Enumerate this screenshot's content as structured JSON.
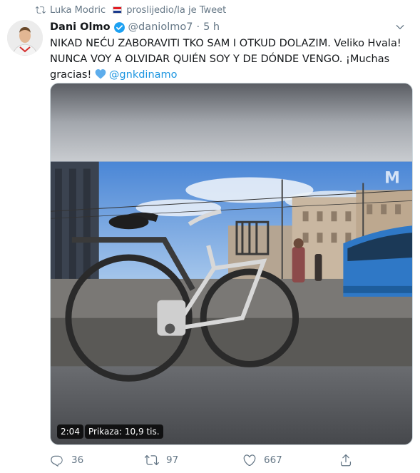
{
  "retweet_context": {
    "user": "Luka Modric",
    "action": "proslijedio/la je Tweet"
  },
  "tweet": {
    "author_name": "Dani Olmo",
    "handle": "@daniolmo7",
    "separator": "·",
    "time": "5 h",
    "text_line1": "NIKAD NEĆU ZABORAVITI TKO SAM I OTKUD DOLAZIM. Veliko Hvala!",
    "text_line2": "NUNCA VOY A OLVIDAR QUIÉN SOY Y DE DÓNDE VENGO. ¡Muchas",
    "text_line3_prefix": "gracias!",
    "mention": "@gnkdinamo"
  },
  "video": {
    "duration": "2:04",
    "views": "Prikaza: 10,9 tis."
  },
  "actions": {
    "reply_count": "36",
    "retweet_count": "97",
    "like_count": "667"
  },
  "colors": {
    "accent": "#1b95e0",
    "muted": "#657786",
    "verified": "#1da1f2"
  },
  "icons": [
    "retweet-icon",
    "croatia-flag-icon",
    "verified-badge-icon",
    "chevron-down-icon",
    "blue-heart-emoji",
    "reply-icon",
    "like-icon",
    "share-icon"
  ]
}
